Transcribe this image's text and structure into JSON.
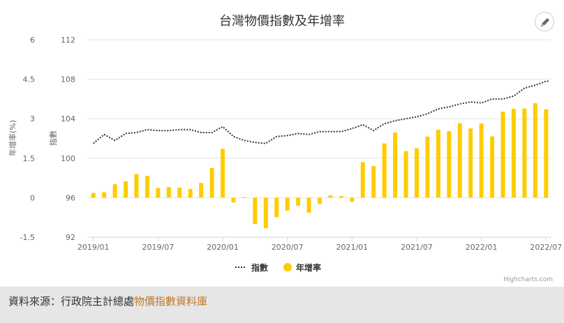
{
  "chart_data": {
    "type": "bar+line",
    "title": "台灣物價指數及年增率",
    "x_ticks": [
      "2019/01",
      "2019/07",
      "2020/01",
      "2020/07",
      "2021/01",
      "2021/07",
      "2022/01",
      "2022/07"
    ],
    "months": [
      "2019/01",
      "2019/02",
      "2019/03",
      "2019/04",
      "2019/05",
      "2019/06",
      "2019/07",
      "2019/08",
      "2019/09",
      "2019/10",
      "2019/11",
      "2019/12",
      "2020/01",
      "2020/02",
      "2020/03",
      "2020/04",
      "2020/05",
      "2020/06",
      "2020/07",
      "2020/08",
      "2020/09",
      "2020/10",
      "2020/11",
      "2020/12",
      "2021/01",
      "2021/02",
      "2021/03",
      "2021/04",
      "2021/05",
      "2021/06",
      "2021/07",
      "2021/08",
      "2021/09",
      "2021/10",
      "2021/11",
      "2021/12",
      "2022/01",
      "2022/02",
      "2022/03",
      "2022/04",
      "2022/05",
      "2022/06",
      "2022/07"
    ],
    "series": [
      {
        "name": "指數",
        "type": "line",
        "axis": "right",
        "color": "#333333",
        "values": [
          101.5,
          102.4,
          101.8,
          102.5,
          102.6,
          102.9,
          102.8,
          102.8,
          102.9,
          102.9,
          102.6,
          102.6,
          103.2,
          102.2,
          101.8,
          101.6,
          101.5,
          102.2,
          102.3,
          102.5,
          102.4,
          102.7,
          102.7,
          102.7,
          103.0,
          103.4,
          102.8,
          103.5,
          103.8,
          104.0,
          104.2,
          104.5,
          105.0,
          105.2,
          105.5,
          105.7,
          105.6,
          106.0,
          106.0,
          106.3,
          107.1,
          107.4,
          107.8,
          107.8
        ]
      },
      {
        "name": "年增率",
        "type": "column",
        "axis": "left",
        "color": "#ffcc00",
        "values": [
          0.18,
          0.21,
          0.51,
          0.62,
          0.9,
          0.83,
          0.37,
          0.4,
          0.38,
          0.33,
          0.56,
          1.13,
          1.86,
          -0.18,
          0.02,
          -1.0,
          -1.16,
          -0.74,
          -0.49,
          -0.3,
          -0.57,
          -0.24,
          0.09,
          0.06,
          -0.16,
          1.35,
          1.2,
          2.06,
          2.48,
          1.77,
          1.88,
          2.32,
          2.58,
          2.53,
          2.83,
          2.63,
          2.82,
          2.33,
          3.27,
          3.38,
          3.39,
          3.59,
          3.36
        ]
      }
    ],
    "y_left": {
      "label": "年增率(%)",
      "min": -1.5,
      "max": 6,
      "ticks": [
        "-1.5",
        "0",
        "1.5",
        "3",
        "4.5",
        "6"
      ]
    },
    "y_right": {
      "label": "指數",
      "min": 92,
      "max": 112,
      "ticks": [
        "92",
        "96",
        "100",
        "104",
        "108",
        "112"
      ]
    },
    "legend": {
      "position": "bottom-center"
    },
    "grid": true
  },
  "ui": {
    "credits": "Highcharts.com",
    "source_prefix": "資料來源：行政院主計總處",
    "source_link": "物價指數資料庫"
  }
}
